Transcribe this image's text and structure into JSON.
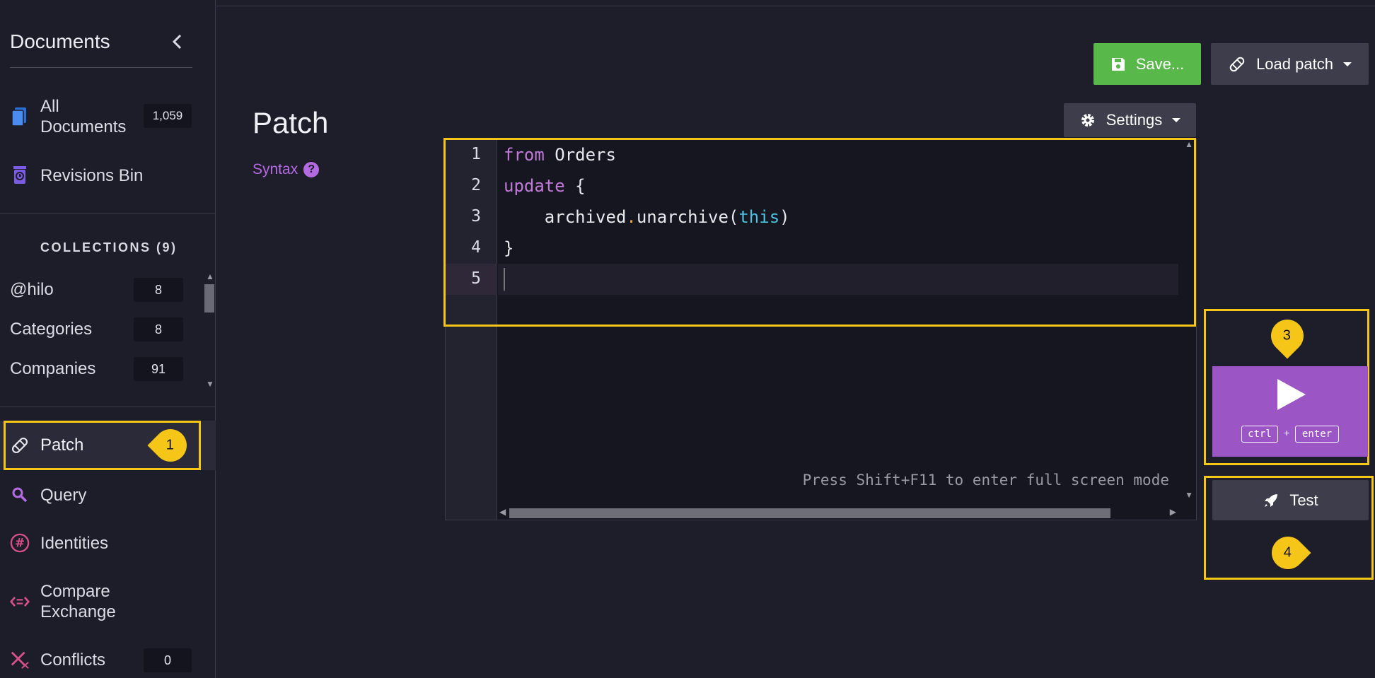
{
  "sidebar": {
    "title": "Documents",
    "all_documents": {
      "label": "All\nDocuments",
      "count": "1,059"
    },
    "revisions_bin": {
      "label": "Revisions Bin"
    },
    "collections_header": "COLLECTIONS (9)",
    "collections": [
      {
        "name": "@hilo",
        "count": "8"
      },
      {
        "name": "Categories",
        "count": "8"
      },
      {
        "name": "Companies",
        "count": "91"
      }
    ],
    "nav": [
      {
        "label": "Patch",
        "icon": "bandage-icon"
      },
      {
        "label": "Query",
        "icon": "search-icon"
      },
      {
        "label": "Identities",
        "icon": "hash-icon"
      },
      {
        "label": "Compare\nExchange",
        "icon": "compare-exchange-icon"
      },
      {
        "label": "Conflicts",
        "icon": "conflicts-icon",
        "count": "0"
      }
    ]
  },
  "main": {
    "title": "Patch",
    "syntax_link": "Syntax",
    "syntax_help": "?",
    "save_label": "Save...",
    "load_patch_label": "Load patch",
    "settings_label": "Settings",
    "fullscreen_hint": "Press Shift+F11 to enter full screen mode",
    "line_numbers": [
      "1",
      "2",
      "3",
      "4",
      "5"
    ],
    "run": {
      "key1": "ctrl",
      "plus": "+",
      "key2": "enter"
    },
    "test_label": "Test"
  },
  "callouts": [
    "1",
    "3",
    "4"
  ],
  "colors": {
    "accent_purple": "#9b55c4",
    "save_green": "#59b84a",
    "highlight_yellow": "#f5c518",
    "background": "#1e1e2b"
  }
}
